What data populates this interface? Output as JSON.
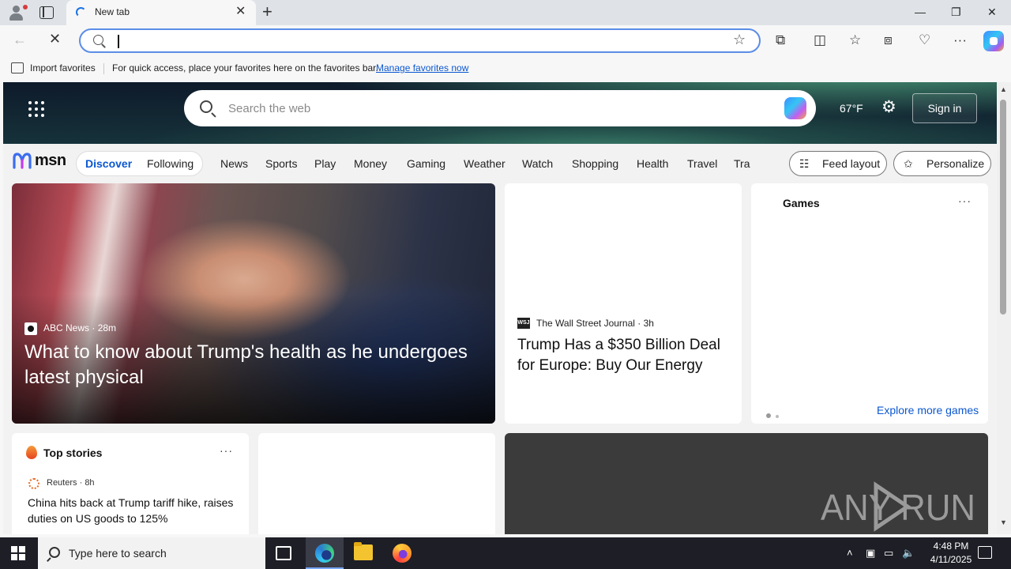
{
  "browser": {
    "tab_title": "New tab",
    "new_tab_symbol": "+",
    "tab_close_symbol": "✕",
    "window_controls": {
      "minimize": "—",
      "restore": "❐",
      "close": "✕"
    },
    "omnibox": {
      "value": "",
      "placeholder": ""
    },
    "toolbar_icons": [
      "back-arrow-icon",
      "stop-loading-icon",
      "favorite-star-icon",
      "extensions-icon",
      "split-screen-icon",
      "favorites-icon",
      "collections-icon",
      "browser-essentials-icon",
      "more-menu-icon",
      "copilot-icon"
    ]
  },
  "favorites_bar": {
    "import_label": "Import favorites",
    "message": "For quick access, place your favorites here on the favorites bar.",
    "link": "Manage favorites now"
  },
  "msn": {
    "search_placeholder": "Search the web",
    "weather": "67°F",
    "sign_in": "Sign in",
    "logo_text": "msn",
    "feed_tabs": [
      "Discover",
      "Following"
    ],
    "categories": [
      "News",
      "Sports",
      "Play",
      "Money",
      "Gaming",
      "Weather",
      "Watch",
      "Shopping",
      "Health",
      "Travel",
      "Tra"
    ],
    "feed_layout": "Feed layout",
    "personalize": "Personalize"
  },
  "cards": {
    "lead": {
      "source": "ABC News",
      "age": "28m",
      "title": "What to know about Trump's health as he undergoes latest physical"
    },
    "wsj": {
      "logo": "WSJ",
      "source": "The Wall Street Journal",
      "age": "3h",
      "title": "Trump Has a $350 Billion Deal for Europe: Buy Our Energy"
    },
    "games": {
      "title": "Games",
      "more": "···",
      "explore": "Explore more games"
    },
    "top_stories": {
      "title": "Top stories",
      "more": "···",
      "source": "Reuters",
      "age": "8h",
      "headline": "China hits back at Trump tariff hike, raises duties on US goods to 125%"
    },
    "watermark": "ANY RUN"
  },
  "taskbar": {
    "search_placeholder": "Type here to search",
    "time": "4:48 PM",
    "date": "4/11/2025"
  }
}
